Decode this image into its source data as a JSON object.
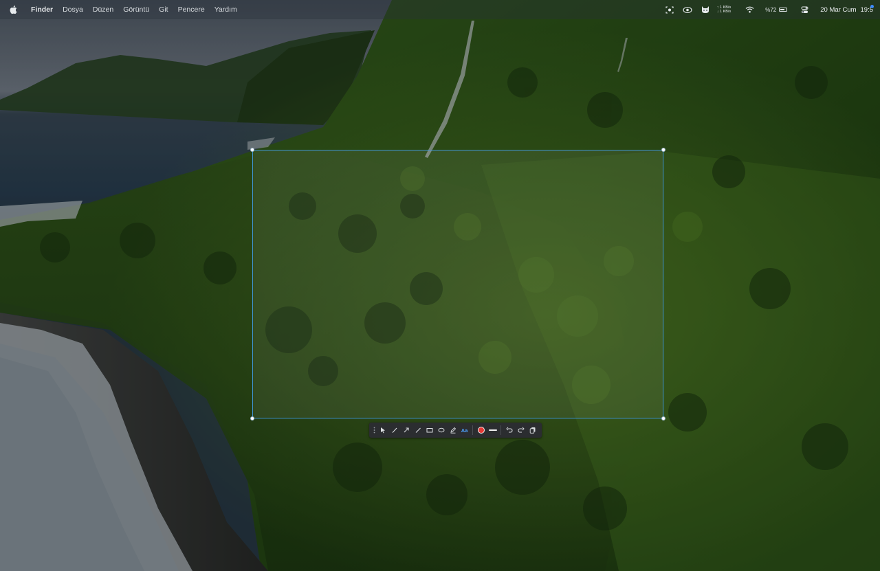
{
  "menubar": {
    "app_name": "Finder",
    "menus": [
      "Dosya",
      "Düzen",
      "Görüntü",
      "Git",
      "Pencere",
      "Yardım"
    ],
    "network": {
      "up": "↑ 1 KB/s",
      "down": "↓ 1 KB/s"
    },
    "battery": "%72",
    "date": "20 Mar Cum",
    "time": "19:5"
  },
  "toolbar": {
    "text_tool_label": "Aa",
    "active_color": "#e53935",
    "tools": [
      "select-icon",
      "pen-icon",
      "arrow-icon",
      "line-icon",
      "rectangle-icon",
      "ellipse-icon",
      "marker-icon",
      "text-icon",
      "color-swatch",
      "stroke-width",
      "undo-icon",
      "redo-icon",
      "copy-icon"
    ]
  },
  "selection": {
    "accent_color": "#3f96d8"
  }
}
